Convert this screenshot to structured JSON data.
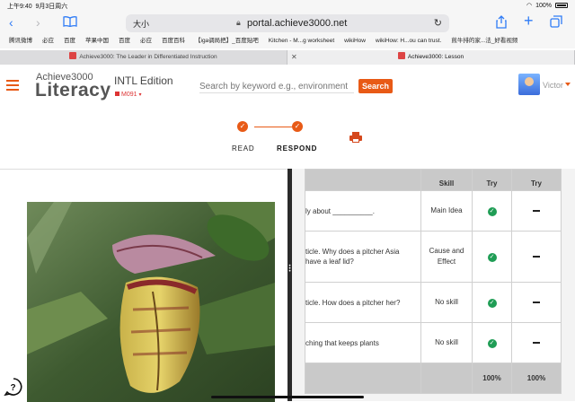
{
  "status_bar": {
    "time": "上午9:40",
    "date": "9月3日周六",
    "battery": "100%"
  },
  "browser": {
    "text_size_label": "大小",
    "url": "portal.achieve3000.net",
    "bookmarks": [
      "腾讯微博",
      "必应",
      "百度",
      "苹果中国",
      "百度",
      "必应",
      "百度百科",
      "【iga调局把】_百度贴吧",
      "Kitchen - M...g worksheet",
      "wikiHow",
      "wikiHow: H...ou can trust.",
      "煎牛排的家...法_好看视频"
    ],
    "tabs": [
      {
        "label": "Achieve3000: The Leader in Differentiated Instruction",
        "active": false
      },
      {
        "label": "Achieve3000: Lesson",
        "active": true
      }
    ]
  },
  "header": {
    "brand_top": "Achieve3000",
    "brand_main": "Literacy",
    "edition": "INTL Edition",
    "level": "M091",
    "search_placeholder": "Search by keyword e.g., environment",
    "search_button": "Search",
    "user_name": "Victor"
  },
  "steps": [
    {
      "label": "READ",
      "done": true
    },
    {
      "label": "RESPOND",
      "done": true
    }
  ],
  "results": {
    "columns": [
      "",
      "Skill",
      "Try",
      "Try"
    ],
    "rows": [
      {
        "question": "ly about __________.",
        "skill": "Main Idea",
        "try1": "check",
        "try2": "dash"
      },
      {
        "question": "ticle. Why does a pitcher Asia have a leaf lid?",
        "skill": "Cause and Effect",
        "try1": "check",
        "try2": "dash"
      },
      {
        "question": "ticle. How does a pitcher her?",
        "skill": "No skill",
        "try1": "check",
        "try2": "dash"
      },
      {
        "question": "ching that keeps plants",
        "skill": "No skill",
        "try1": "check",
        "try2": "dash"
      }
    ],
    "totals": {
      "try1": "100%",
      "try2": "100%"
    }
  },
  "colors": {
    "accent": "#e85a16",
    "check": "#1f9d55",
    "ios_blue": "#2f7cf6"
  }
}
